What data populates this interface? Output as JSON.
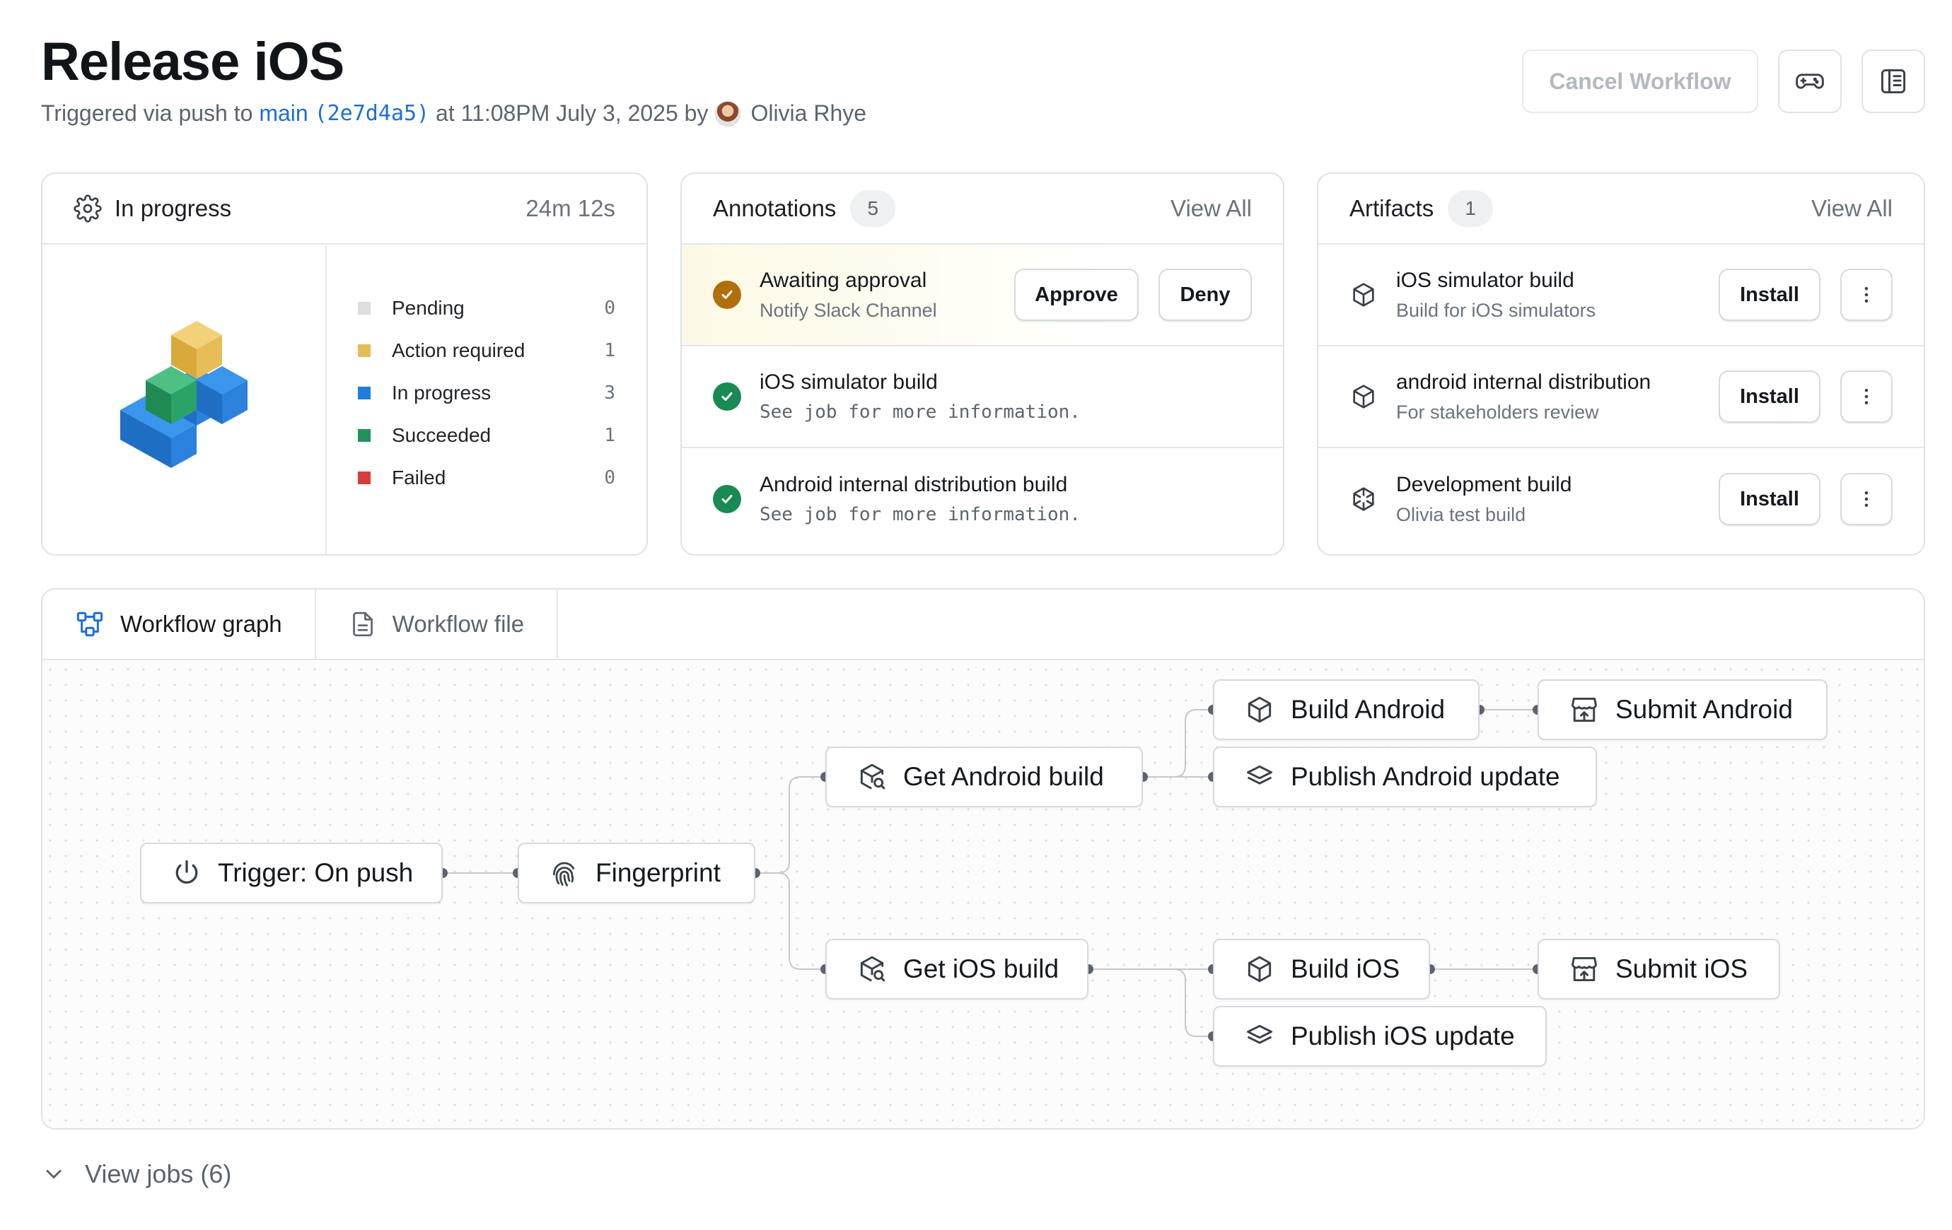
{
  "header": {
    "title": "Release iOS",
    "trigger_prefix": "Triggered via push to",
    "branch": "main",
    "commit": "(2e7d4a5)",
    "time_text": "at 11:08PM July 3, 2025 by",
    "user": "Olivia Rhye",
    "cancel_label": "Cancel Workflow",
    "icons": [
      "gamepad-icon",
      "sidebar-panel-icon"
    ]
  },
  "status": {
    "label": "In progress",
    "duration": "24m 12s",
    "legend": [
      {
        "label": "Pending",
        "count": "0",
        "color": "#dedede"
      },
      {
        "label": "Action required",
        "count": "1",
        "color": "#e5bd57"
      },
      {
        "label": "In progress",
        "count": "3",
        "color": "#1e7fd8"
      },
      {
        "label": "Succeeded",
        "count": "1",
        "color": "#22915c"
      },
      {
        "label": "Failed",
        "count": "0",
        "color": "#d83b3b"
      }
    ]
  },
  "annotations": {
    "title": "Annotations",
    "count": "5",
    "view_all": "View All",
    "items": [
      {
        "title": "Awaiting approval",
        "detail": "Notify Slack Channel",
        "status": "action-required",
        "approve": "Approve",
        "deny": "Deny"
      },
      {
        "title": "iOS simulator build",
        "detail": "See job for more information.",
        "status": "succeeded"
      },
      {
        "title": "Android internal distribution build",
        "detail": "See job for more information.",
        "status": "succeeded"
      }
    ]
  },
  "artifacts": {
    "title": "Artifacts",
    "count": "1",
    "view_all": "View All",
    "install_label": "Install",
    "items": [
      {
        "title": "iOS simulator build",
        "detail": "Build for iOS simulators",
        "icon": "cube-icon"
      },
      {
        "title": "android internal distribution",
        "detail": "For stakeholders review",
        "icon": "cube-icon"
      },
      {
        "title": "Development build",
        "detail": "Olivia test build",
        "icon": "aperture-icon"
      }
    ]
  },
  "tabs": [
    {
      "label": "Workflow graph",
      "icon": "graph-icon",
      "active": true
    },
    {
      "label": "Workflow file",
      "icon": "file-icon",
      "active": false
    }
  ],
  "graph": {
    "nodes": {
      "trigger": "Trigger: On push",
      "fingerprint": "Fingerprint",
      "get_android": "Get Android build",
      "get_ios": "Get iOS build",
      "build_android": "Build Android",
      "publish_android": "Publish Android update",
      "build_ios": "Build iOS",
      "publish_ios": "Publish iOS update",
      "submit_android": "Submit Android",
      "submit_ios": "Submit iOS"
    }
  },
  "footer": {
    "view_jobs": "View jobs (6)"
  }
}
